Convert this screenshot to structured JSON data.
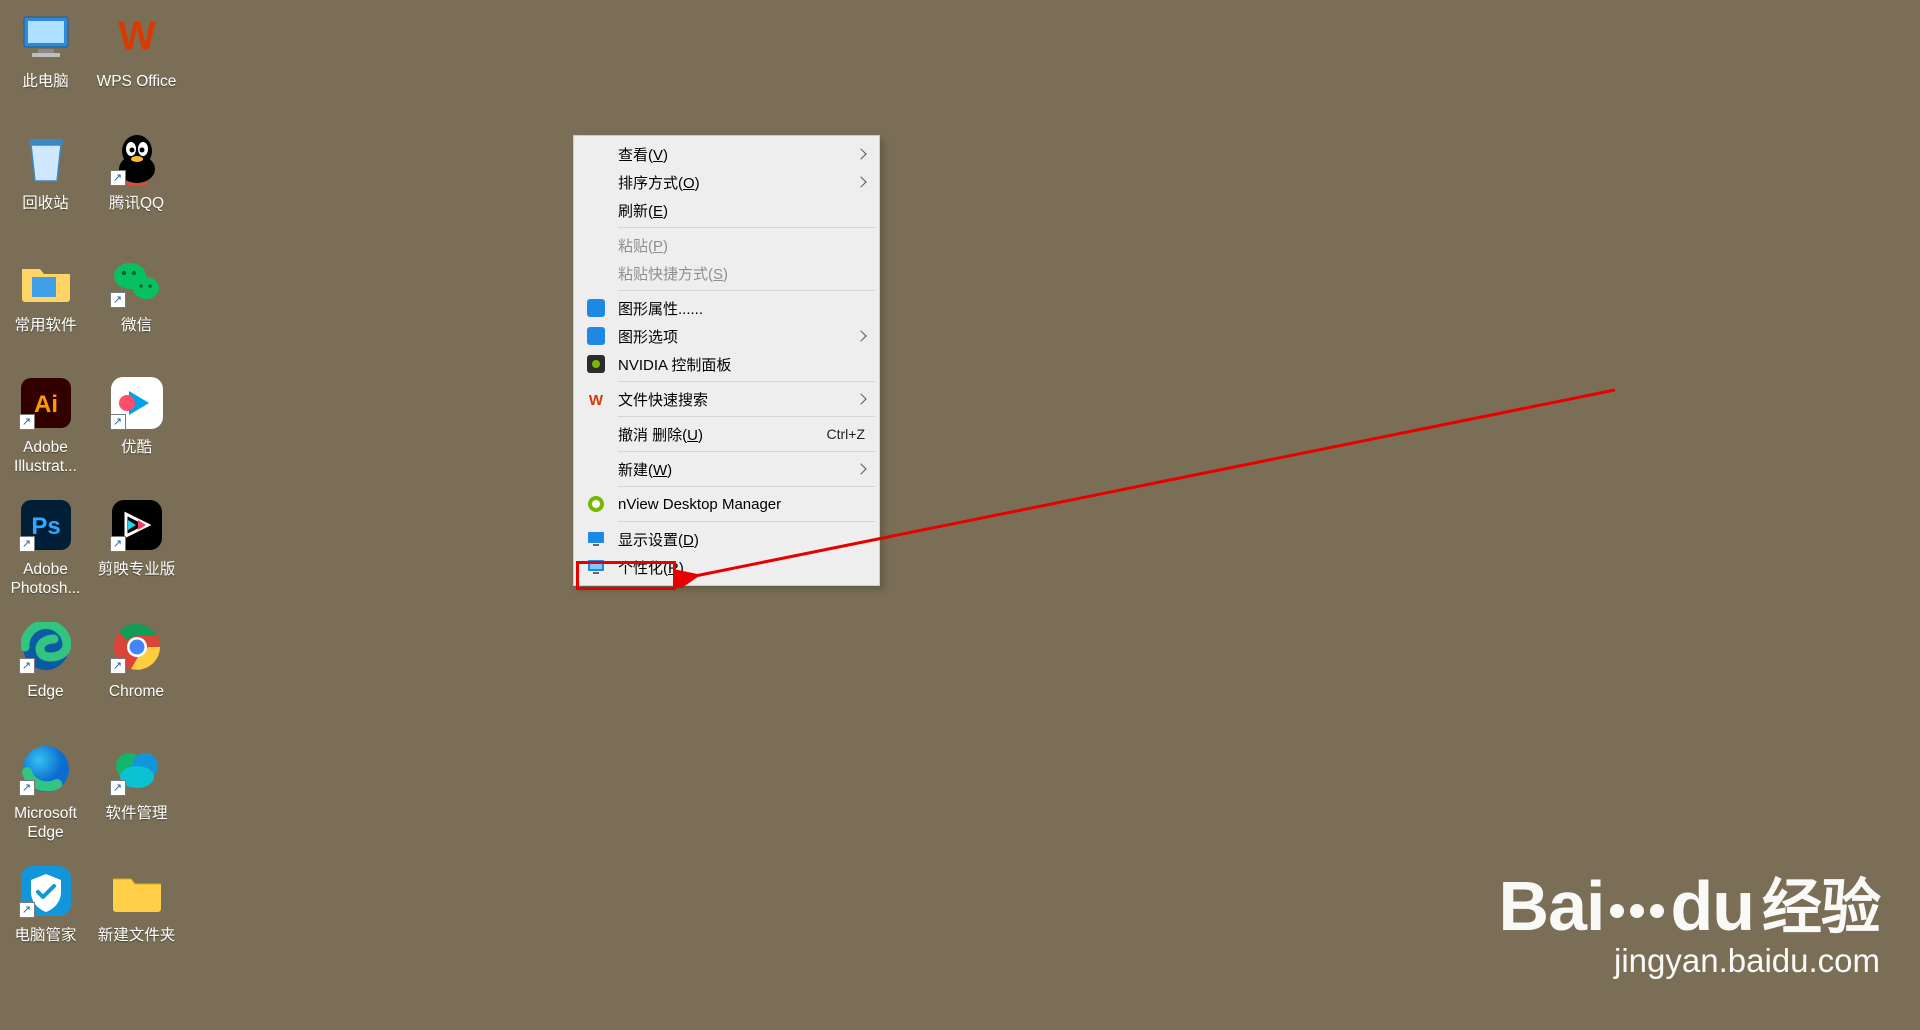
{
  "desktop": {
    "icons": [
      {
        "id": "this-pc",
        "label": "此电脑",
        "type": "pc",
        "shortcut": false
      },
      {
        "id": "wps",
        "label": "WPS Office",
        "type": "wps",
        "shortcut": false
      },
      {
        "id": "recycle",
        "label": "回收站",
        "type": "bin",
        "shortcut": false
      },
      {
        "id": "qq",
        "label": "腾讯QQ",
        "type": "qq",
        "shortcut": true
      },
      {
        "id": "common",
        "label": "常用软件",
        "type": "folder",
        "shortcut": false
      },
      {
        "id": "wechat",
        "label": "微信",
        "type": "wechat",
        "shortcut": true
      },
      {
        "id": "ai",
        "label": "Adobe Illustrat...",
        "type": "ai",
        "shortcut": true
      },
      {
        "id": "youku",
        "label": "优酷",
        "type": "youku",
        "shortcut": true
      },
      {
        "id": "ps",
        "label": "Adobe Photosh...",
        "type": "ps",
        "shortcut": true
      },
      {
        "id": "jianying",
        "label": "剪映专业版",
        "type": "jy",
        "shortcut": true
      },
      {
        "id": "edge",
        "label": "Edge",
        "type": "edge",
        "shortcut": true
      },
      {
        "id": "chrome",
        "label": "Chrome",
        "type": "chrome",
        "shortcut": true
      },
      {
        "id": "msedge",
        "label": "Microsoft Edge",
        "type": "edge2",
        "shortcut": true
      },
      {
        "id": "swmgr",
        "label": "软件管理",
        "type": "swmgr",
        "shortcut": true
      },
      {
        "id": "pcmgr",
        "label": "电脑管家",
        "type": "pcmgr",
        "shortcut": true
      },
      {
        "id": "newfolder",
        "label": "新建文件夹",
        "type": "folder2",
        "shortcut": false
      }
    ]
  },
  "context_menu": {
    "items": [
      {
        "label_pre": "查看(",
        "hotkey": "V",
        "label_post": ")",
        "submenu": true,
        "icon": ""
      },
      {
        "label_pre": "排序方式(",
        "hotkey": "O",
        "label_post": ")",
        "submenu": true,
        "icon": ""
      },
      {
        "label_pre": "刷新(",
        "hotkey": "E",
        "label_post": ")",
        "submenu": false,
        "icon": ""
      },
      "sep",
      {
        "label_pre": "粘贴(",
        "hotkey": "P",
        "label_post": ")",
        "submenu": false,
        "icon": "",
        "disabled": true
      },
      {
        "label_pre": "粘贴快捷方式(",
        "hotkey": "S",
        "label_post": ")",
        "submenu": false,
        "icon": "",
        "disabled": true
      },
      "sep",
      {
        "label": "图形属性......",
        "submenu": false,
        "icon": "intel-blue"
      },
      {
        "label": "图形选项",
        "submenu": true,
        "icon": "intel-blue"
      },
      {
        "label": "NVIDIA 控制面板",
        "submenu": false,
        "icon": "nvidia"
      },
      "sep",
      {
        "label": "文件快速搜索",
        "submenu": true,
        "icon": "wps-red"
      },
      "sep",
      {
        "label_pre": "撤消 删除(",
        "hotkey": "U",
        "label_post": ")",
        "shortcut": "Ctrl+Z",
        "icon": ""
      },
      "sep",
      {
        "label_pre": "新建(",
        "hotkey": "W",
        "label_post": ")",
        "submenu": true,
        "icon": ""
      },
      "sep",
      {
        "label": "nView Desktop Manager",
        "submenu": false,
        "icon": "nvidia-green"
      },
      "sep",
      {
        "label_pre": "显示设置(",
        "hotkey": "D",
        "label_post": ")",
        "submenu": false,
        "icon": "monitor"
      },
      {
        "label_pre": "个性化(",
        "hotkey": "R",
        "label_post": ")",
        "submenu": false,
        "icon": "monitor2",
        "highlighted": true
      }
    ]
  },
  "watermark": {
    "brand": "Bai",
    "du": "du",
    "zh": "经验",
    "url": "jingyan.baidu.com"
  }
}
